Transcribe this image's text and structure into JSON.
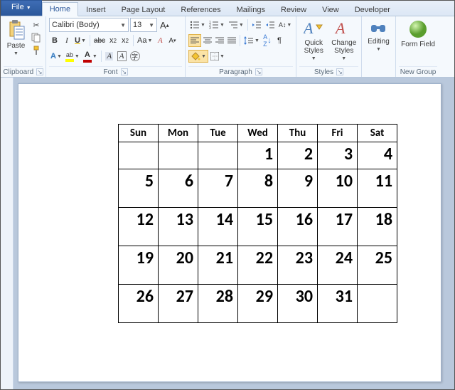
{
  "tabs": {
    "file": "File",
    "home": "Home",
    "insert": "Insert",
    "pageLayout": "Page Layout",
    "references": "References",
    "mailings": "Mailings",
    "review": "Review",
    "view": "View",
    "developer": "Developer"
  },
  "ribbon": {
    "clipboard": {
      "label": "Clipboard",
      "paste": "Paste"
    },
    "font": {
      "label": "Font",
      "name": "Calibri (Body)",
      "size": "13",
      "bold": "B",
      "italic": "I",
      "underline": "U",
      "strike": "abc",
      "sub": "x",
      "subn": "2",
      "sup": "x",
      "supn": "2",
      "caseAa": "Aa",
      "clearA": "A",
      "growA": "A",
      "shrinkA": "A",
      "highlightA": "A",
      "fontColorA": "A",
      "effectsA": "A",
      "shadowA": "A"
    },
    "paragraph": {
      "label": "Paragraph"
    },
    "styles": {
      "label": "Styles",
      "quick": "Quick Styles",
      "change": "Change Styles"
    },
    "editing": {
      "label": "Editing"
    },
    "newgroup": {
      "label": "New Group",
      "formfield": "Form Field"
    }
  },
  "calendar": {
    "headers": [
      "Sun",
      "Mon",
      "Tue",
      "Wed",
      "Thu",
      "Fri",
      "Sat"
    ],
    "rows": [
      [
        "",
        "",
        "",
        "1",
        "2",
        "3",
        "4"
      ],
      [
        "5",
        "6",
        "7",
        "8",
        "9",
        "10",
        "11"
      ],
      [
        "12",
        "13",
        "14",
        "15",
        "16",
        "17",
        "18"
      ],
      [
        "19",
        "20",
        "21",
        "22",
        "23",
        "24",
        "25"
      ],
      [
        "26",
        "27",
        "28",
        "29",
        "30",
        "31",
        ""
      ]
    ]
  }
}
